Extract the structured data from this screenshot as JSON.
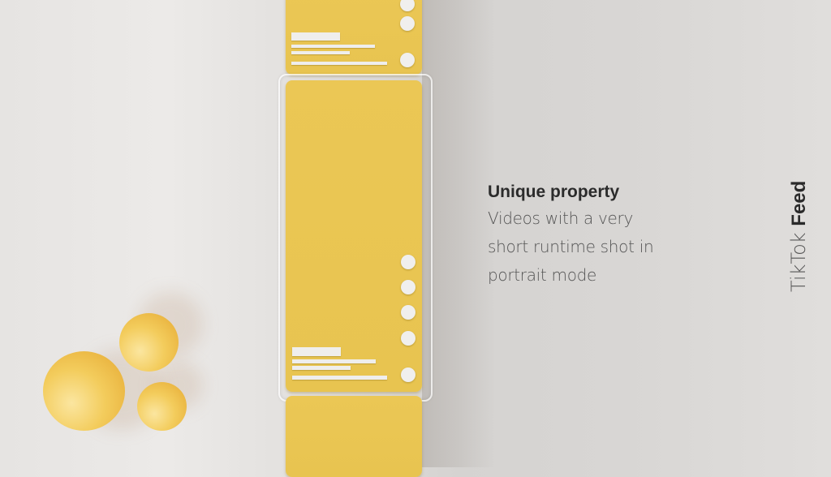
{
  "slide": {
    "heading": "Unique property",
    "description_lines": [
      "Videos with a very",
      "short runtime shot in",
      "portrait mode"
    ],
    "side_title": {
      "light": "TikTok",
      "bold": "Feed"
    }
  },
  "illustration": {
    "feed_cards": [
      "top-card",
      "main-card",
      "bottom-card"
    ],
    "accent_color": "#E9C552",
    "ui_element_color": "#F0EFED",
    "sphere_count": 3
  }
}
